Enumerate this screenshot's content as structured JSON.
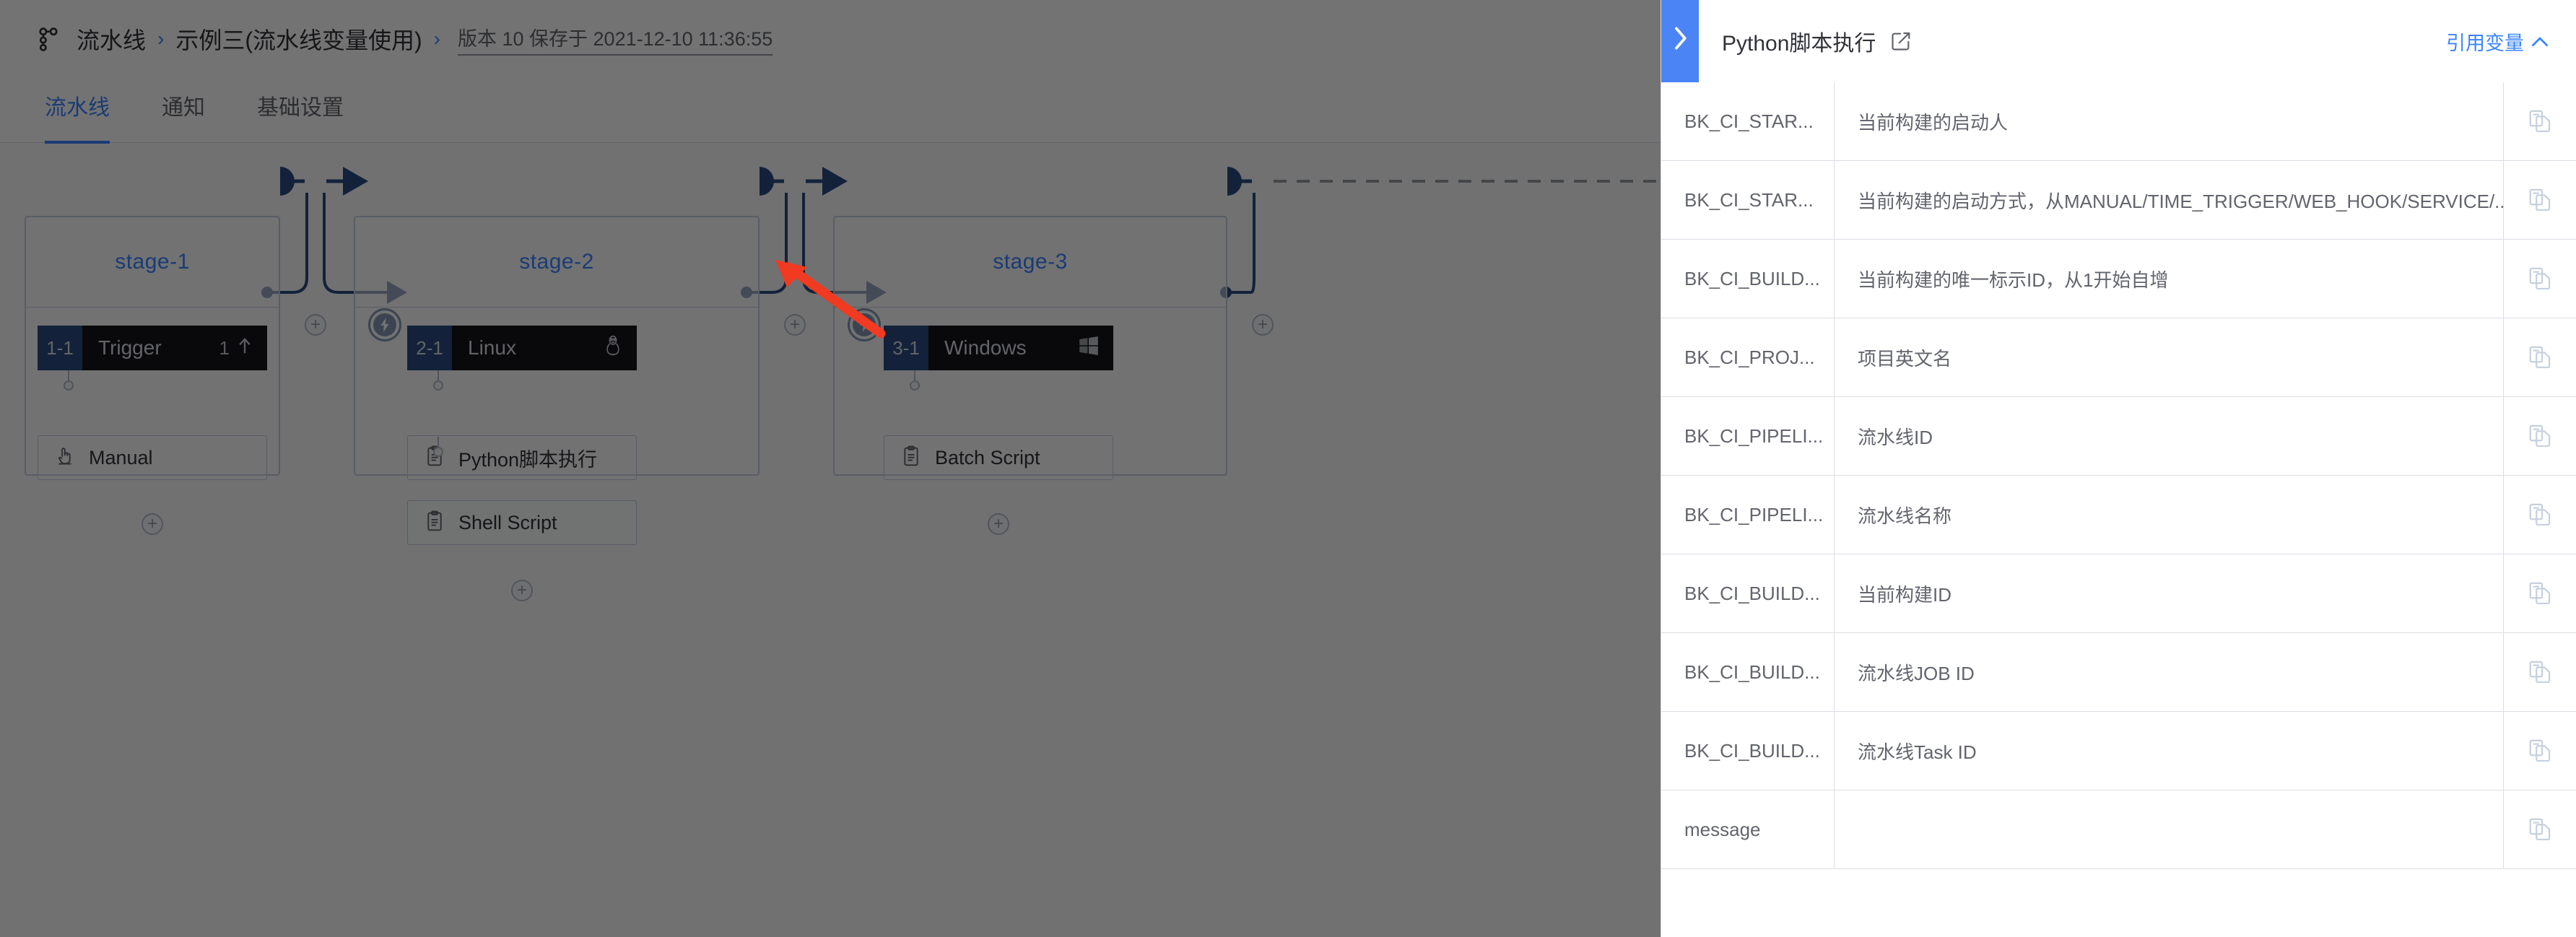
{
  "breadcrumb": {
    "icon": "pipeline-icon",
    "root": "流水线",
    "separator": "›",
    "project": "示例三(流水线变量使用)",
    "version_info": "版本 10 保存于 2021-12-10 11:36:55"
  },
  "tabs": [
    {
      "label": "流水线",
      "active": true
    },
    {
      "label": "通知",
      "active": false
    },
    {
      "label": "基础设置",
      "active": false
    }
  ],
  "pipeline": {
    "stages": [
      {
        "title": "stage-1",
        "jobs": [
          {
            "index": "1-1",
            "name": "Trigger",
            "right_label": "1",
            "right_icon": "arrow-up-icon",
            "os_icon": "",
            "atoms": [
              {
                "icon": "manual-hand-icon",
                "label": "Manual"
              }
            ]
          }
        ]
      },
      {
        "title": "stage-2",
        "jobs": [
          {
            "index": "2-1",
            "name": "Linux",
            "right_label": "",
            "right_icon": "",
            "os_icon": "linux-penguin-icon",
            "atoms": [
              {
                "icon": "script-clipboard-icon",
                "label": "Python脚本执行"
              },
              {
                "icon": "script-clipboard-icon",
                "label": "Shell Script"
              }
            ]
          }
        ]
      },
      {
        "title": "stage-3",
        "jobs": [
          {
            "index": "3-1",
            "name": "Windows",
            "right_label": "",
            "right_icon": "",
            "os_icon": "windows-logo-icon",
            "atoms": [
              {
                "icon": "script-clipboard-icon",
                "label": "Batch Script"
              }
            ]
          }
        ]
      }
    ],
    "add_stage_label": "+",
    "trigger_icon": "lightning-bolt-icon"
  },
  "panel": {
    "collapse_icon": "chevron-right-icon",
    "title": "Python脚本执行",
    "edit_icon": "edit-pencil-square-icon",
    "ref_var_label": "引用变量",
    "ref_var_chevron": "∧",
    "copy_icon": "copy-icon",
    "variables": [
      {
        "name": "BK_CI_STAR...",
        "desc": "当前构建的启动人"
      },
      {
        "name": "BK_CI_STAR...",
        "desc": "当前构建的启动方式，从MANUAL/TIME_TRIGGER/WEB_HOOK/SERVICE/..."
      },
      {
        "name": "BK_CI_BUILD...",
        "desc": "当前构建的唯一标示ID，从1开始自增"
      },
      {
        "name": "BK_CI_PROJ...",
        "desc": "项目英文名"
      },
      {
        "name": "BK_CI_PIPELI...",
        "desc": "流水线ID"
      },
      {
        "name": "BK_CI_PIPELI...",
        "desc": "流水线名称"
      },
      {
        "name": "BK_CI_BUILD...",
        "desc": "当前构建ID"
      },
      {
        "name": "BK_CI_BUILD...",
        "desc": "流水线JOB ID"
      },
      {
        "name": "BK_CI_BUILD...",
        "desc": "流水线Task ID"
      },
      {
        "name": "message",
        "desc": ""
      }
    ]
  },
  "colors": {
    "accent_blue": "#3a84ff",
    "panel_tab_blue": "#4a84f5",
    "job_header_dark": "#16161a",
    "job_index_blue": "#2b4c80",
    "connector_blue": "#2b4c80",
    "annotation_red": "#f03a21"
  }
}
